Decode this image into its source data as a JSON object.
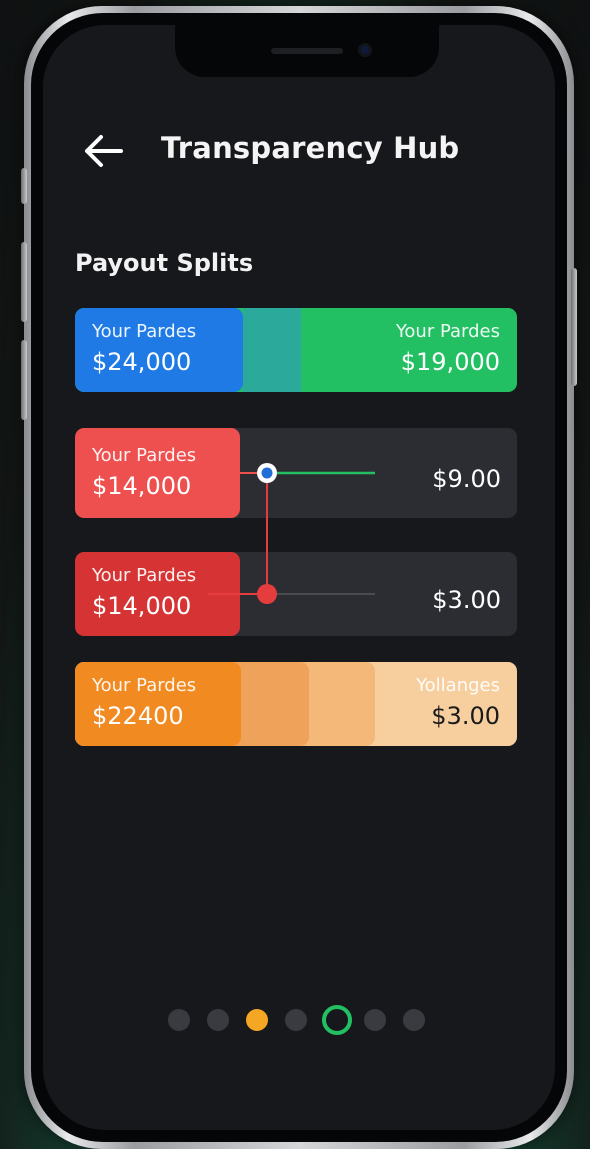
{
  "header": {
    "title": "Transparency Hub",
    "back_icon": "arrow-left-icon"
  },
  "section": {
    "title": "Payout Splits"
  },
  "cards": [
    {
      "left_label": "Your Pardes",
      "left_amount": "$24,000",
      "right_label": "Your Pardes",
      "right_amount": "$19,000",
      "colors": [
        "#1f7ae6",
        "#2ba99a",
        "#22c063"
      ]
    },
    {
      "left_label": "Your Pardes",
      "left_amount": "$14,000",
      "right_amount": "$9.00",
      "slider_value": 0.2,
      "colors": [
        "#ee4f4f",
        "#1f6fd6",
        "#22c063"
      ]
    },
    {
      "left_label": "Your Pardes",
      "left_amount": "$14,000",
      "right_amount": "$3.00",
      "slider_value": 0.2,
      "colors": [
        "#d63434",
        "#e53d3d"
      ]
    },
    {
      "left_label": "Your Pardes",
      "left_amount": "$22400",
      "right_label": "Yollanges",
      "right_amount": "$3.00",
      "colors": [
        "#f28a22",
        "#efa35a",
        "#f4b978",
        "#f7cf9f"
      ]
    }
  ],
  "pagination": {
    "count": 7,
    "active_index": 2,
    "ring_index": 4,
    "active_color": "#f5a623",
    "ring_color": "#22c063"
  }
}
